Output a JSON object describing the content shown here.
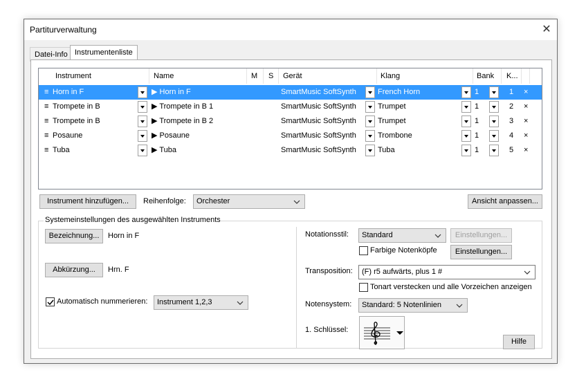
{
  "window": {
    "title": "Partiturverwaltung"
  },
  "tabs": [
    {
      "label": "Datei-Info"
    },
    {
      "label": "Instrumentenliste"
    }
  ],
  "table": {
    "columns": [
      "Instrument",
      "Name",
      "M",
      "S",
      "Gerät",
      "Klang",
      "Bank",
      "K..."
    ],
    "rows": [
      {
        "instrument": "Horn in F",
        "name": "▶ Horn in F",
        "device": "SmartMusic SoftSynth",
        "sound": "French Horn",
        "bank": "1",
        "channel": "1"
      },
      {
        "instrument": "Trompete in B",
        "name": "▶ Trompete in B 1",
        "device": "SmartMusic SoftSynth",
        "sound": "Trumpet",
        "bank": "1",
        "channel": "2"
      },
      {
        "instrument": "Trompete in B",
        "name": "▶ Trompete in B 2",
        "device": "SmartMusic SoftSynth",
        "sound": "Trumpet",
        "bank": "1",
        "channel": "3"
      },
      {
        "instrument": "Posaune",
        "name": "▶ Posaune",
        "device": "SmartMusic SoftSynth",
        "sound": "Trombone",
        "bank": "1",
        "channel": "4"
      },
      {
        "instrument": "Tuba",
        "name": "▶ Tuba",
        "device": "SmartMusic SoftSynth",
        "sound": "Tuba",
        "bank": "1",
        "channel": "5"
      }
    ],
    "drag_glyph": "≡",
    "delete_glyph": "×"
  },
  "toolbar": {
    "add_instrument": "Instrument hinzufügen...",
    "order_label": "Reihenfolge:",
    "order_value": "Orchester",
    "customize_view": "Ansicht anpassen..."
  },
  "settings": {
    "group_title": "Systemeinstellungen des ausgewählten Instruments",
    "designation_button": "Bezeichnung...",
    "designation_value": "Horn in F",
    "abbreviation_button": "Abkürzung...",
    "abbreviation_value": "Hrn. F",
    "auto_number_label": "Automatisch nummerieren:",
    "auto_number_checked": true,
    "auto_number_value": "Instrument 1,2,3",
    "notation_style_label": "Notationsstil:",
    "notation_style_value": "Standard",
    "settings_button_disabled": "Einstellungen...",
    "colored_noteheads_label": "Farbige Notenköpfe",
    "colored_noteheads_checked": false,
    "settings_button": "Einstellungen...",
    "transposition_label": "Transposition:",
    "transposition_value": "(F) r5 aufwärts, plus 1 #",
    "hide_key_label": "Tonart verstecken und alle Vorzeichen anzeigen",
    "hide_key_checked": false,
    "staff_system_label": "Notensystem:",
    "staff_system_value": "Standard: 5 Notenlinien",
    "first_clef_label": "1. Schlüssel:",
    "help_button": "Hilfe"
  }
}
